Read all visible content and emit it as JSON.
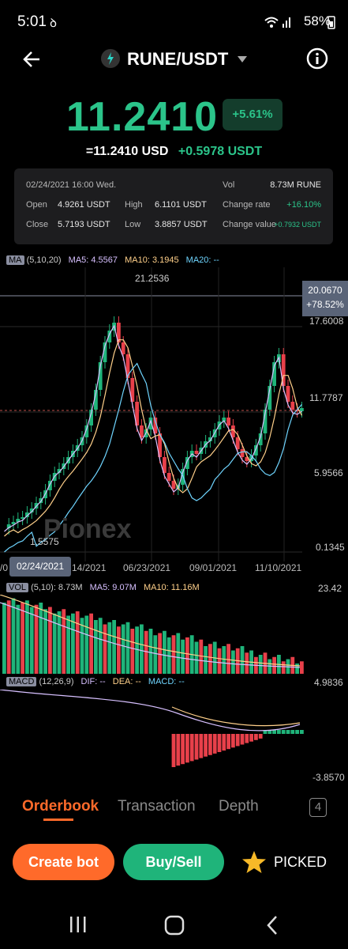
{
  "status": {
    "time": "5:01",
    "battery": "58%",
    "icons": [
      "tiktok-icon",
      "wifi-icon",
      "signal-icon",
      "battery-icon"
    ]
  },
  "header": {
    "pair": "RUNE/USDT",
    "icons": [
      "back-arrow-icon",
      "rune-logo-icon",
      "dropdown-icon",
      "info-icon"
    ]
  },
  "ticker": {
    "price": "11.2410",
    "change_pct": "+5.61%",
    "usd_value": "=11.2410 USD",
    "change_abs": "+0.5978 USDT"
  },
  "card": {
    "datetime": "02/24/2021 16:00 Wed.",
    "open_label": "Open",
    "open": "4.9261 USDT",
    "high_label": "High",
    "high": "6.1101 USDT",
    "close_label": "Close",
    "close": "5.7193 USDT",
    "low_label": "Low",
    "low": "3.8857 USDT",
    "vol_label": "Vol",
    "vol": "8.73M RUNE",
    "rate_label": "Change rate",
    "rate": "+16.10%",
    "cv_label": "Change value",
    "cv": "+0.7932 USDT"
  },
  "chart": {
    "ma_tag": "MA",
    "ma_params": "(5,10,20)",
    "ma5": "MA5: 4.5567",
    "ma10": "MA10: 3.1945",
    "ma20": "MA20: --",
    "high_mark": "21.2536",
    "low_mark": "1.5575",
    "current_price": "20.0670",
    "current_pct": "+78.52%",
    "axis": [
      "17.6008",
      "11.7787",
      "5.9566",
      "0.1345"
    ],
    "dates": [
      "/0",
      "14/2021",
      "06/23/2021",
      "09/01/2021",
      "11/10/2021"
    ],
    "selected_date": "02/24/2021",
    "watermark": "Pionex",
    "vol_tag": "VOL",
    "vol_params": "(5,10): 8.73M",
    "vol_ma5": "MA5: 9.07M",
    "vol_ma10": "MA10: 11.16M",
    "vol_max": "23.42",
    "macd_tag": "MACD",
    "macd_params": "(12,26,9)",
    "dif": "DIF: --",
    "dea": "DEA: --",
    "macd": "MACD: --",
    "macd_max": "4.9836",
    "macd_min": "-3.8570",
    "colors": {
      "up": "#1fb47a",
      "down": "#e8404a",
      "ma5": "#d7c0ff",
      "ma10": "#ffd08a",
      "ma20": "#6fd5ff"
    }
  },
  "tabs": {
    "orderbook": "Orderbook",
    "transaction": "Transaction",
    "depth": "Depth",
    "count": "4"
  },
  "actions": {
    "create_bot": "Create bot",
    "buy_sell": "Buy/Sell",
    "picked": "PICKED"
  },
  "nav": {
    "icons": [
      "recents-icon",
      "home-icon",
      "back-icon"
    ]
  }
}
